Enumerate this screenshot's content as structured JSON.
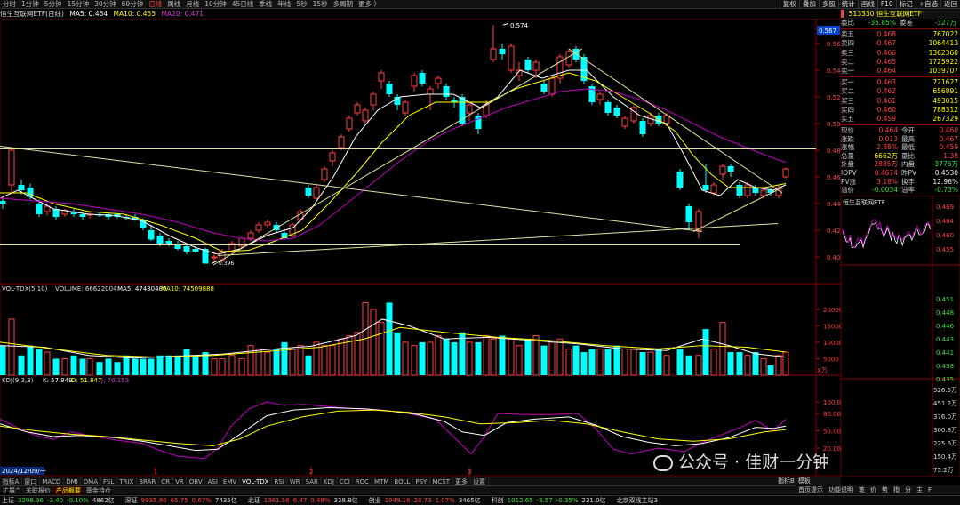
{
  "toolbar": {
    "periods": [
      "分时",
      "1分钟",
      "5分钟",
      "15分钟",
      "30分钟",
      "60分钟",
      "日线",
      "周线",
      "月线",
      "10分钟",
      "45日线",
      "季线",
      "年线",
      "5秒",
      "15秒",
      "多周期",
      "更多 〉"
    ],
    "active_period": "日线",
    "right_buttons": [
      "复权",
      "叠加",
      "多股",
      "统计",
      "画线",
      "F10",
      "标记",
      "+自选",
      "返回"
    ]
  },
  "chart_header": {
    "name": "恒生互联网ETF(日线)",
    "ma5": "MA5: 0.454",
    "ma10": "MA10: 0.455",
    "ma20": "MA20: 0.471"
  },
  "price_axis": {
    "labels": [
      "0.560",
      "0.540",
      "0.520",
      "0.500",
      "0.480",
      "0.460",
      "0.440",
      "0.420",
      "0.400"
    ],
    "current_price_tag": "0.567",
    "high_label": "0.574",
    "low_label": "0.396"
  },
  "volume_header": {
    "name": "VOL-TDX(5,10)",
    "volume": "VOLUME: 66622004",
    "ma5": "MA5: 47430480",
    "ma10": "MA10: 74509888"
  },
  "volume_axis": {
    "labels": [
      "20000",
      "15000",
      "10000",
      "5000"
    ],
    "unit": "X万"
  },
  "kdj_header": {
    "name": "KDJ(9,3,3)",
    "k": "K: 57.949",
    "d": "D: 51.847",
    "j": "J: 70.153"
  },
  "kdj_axis": {
    "labels": [
      "100.00",
      "80.00",
      "50.00",
      "20.00"
    ]
  },
  "date_label": "2024/12/09/一",
  "month_marks": [
    "1",
    "2",
    "3"
  ],
  "quote": {
    "code": "513330 恒生互联网ETF",
    "weibi_label": "委比",
    "weibi": "-35.85%",
    "weicha_label": "委差",
    "weicha": "-327万",
    "asks": [
      {
        "label": "卖五",
        "price": "0.468",
        "vol": "767022"
      },
      {
        "label": "卖四",
        "price": "0.467",
        "vol": "1064413"
      },
      {
        "label": "卖三",
        "price": "0.466",
        "vol": "1362360"
      },
      {
        "label": "卖二",
        "price": "0.465",
        "vol": "1725922"
      },
      {
        "label": "卖一",
        "price": "0.464",
        "vol": "1039707"
      }
    ],
    "bids": [
      {
        "label": "买一",
        "price": "0.463",
        "vol": "721627"
      },
      {
        "label": "买二",
        "price": "0.462",
        "vol": "656891"
      },
      {
        "label": "买三",
        "price": "0.461",
        "vol": "493015"
      },
      {
        "label": "买四",
        "price": "0.460",
        "vol": "788312"
      },
      {
        "label": "买五",
        "price": "0.459",
        "vol": "267329"
      }
    ],
    "stats": [
      {
        "l1": "现价",
        "v1": "0.464",
        "c1": "red",
        "l2": "今开",
        "v2": "0.460",
        "c2": "red"
      },
      {
        "l1": "涨跌",
        "v1": "0.013",
        "c1": "red",
        "l2": "最高",
        "v2": "0.467",
        "c2": "red"
      },
      {
        "l1": "涨幅",
        "v1": "2.88%",
        "c1": "red",
        "l2": "最低",
        "v2": "0.459",
        "c2": "red"
      },
      {
        "l1": "总量",
        "v1": "6662万",
        "c1": "yel",
        "l2": "量比",
        "v2": "1.38",
        "c2": "red"
      },
      {
        "l1": "外盘",
        "v1": "2885万",
        "c1": "red",
        "l2": "内盘",
        "v2": "3776万",
        "c2": "grn"
      },
      {
        "l1": "IOPV",
        "v1": "0.4674",
        "c1": "red",
        "l2": "昨PV",
        "v2": "0.4530",
        "c2": "wht"
      },
      {
        "l1": "PV涨",
        "v1": "3.18%",
        "c1": "red",
        "l2": "换手",
        "v2": "12.96%",
        "c2": "wht"
      },
      {
        "l1": "溢价",
        "v1": "-0.0034",
        "c1": "grn",
        "l2": "溢率",
        "v2": "-0.73%",
        "c2": "grn"
      }
    ]
  },
  "mini_chart": {
    "title": "恒生互联网ETF",
    "price_labels": [
      "0.469",
      "0.464",
      "0.460",
      "0.455"
    ],
    "vol_labels": [
      "0.451",
      "0.448",
      "0.446",
      "0.443",
      "0.441",
      "0.438",
      "0.435"
    ],
    "amt_labels": [
      "526.5万",
      "451.2万",
      "376.0万",
      "300.8万",
      "225.6万",
      "150.4万",
      "75.2万"
    ]
  },
  "indicator_tabs": [
    "指标A",
    "窗口",
    "MACD",
    "DMI",
    "DMA",
    "FSL",
    "TRIX",
    "BRAR",
    "CR",
    "VR",
    "OBV",
    "ASI",
    "EMV",
    "VOL-TDX",
    "RSI",
    "WR",
    "SAR",
    "KDJ",
    "CCI",
    "ROC",
    "MTM",
    "BOLL",
    "PSY",
    "MCST",
    "更多",
    "设置"
  ],
  "active_indicator": "VOL-TDX",
  "bottom_right_tabs": [
    "指标B",
    "模板"
  ],
  "sub_tabs": [
    "扩展^",
    "关联报价",
    "产品概要",
    "基金持仓"
  ],
  "active_sub_tab": "产品概要",
  "mini_tabs": [
    "首页提示",
    "功能说明",
    "笔",
    "价",
    "势",
    "指",
    "分",
    "主",
    "F"
  ],
  "status": [
    {
      "name": "上证",
      "val": "3298.36",
      "chg": "-3.40",
      "pct": "-0.10%",
      "amt": "4862亿"
    },
    {
      "name": "深证",
      "val": "9935.80",
      "chg": "65.75",
      "pct": "0.67%",
      "amt": "7435亿"
    },
    {
      "name": "北证",
      "val": "1361.56",
      "chg": "6.47",
      "pct": "0.48%",
      "amt": "328.8亿"
    },
    {
      "name": "创业",
      "val": "1949.16",
      "chg": "20.73",
      "pct": "1.07%",
      "amt": "3465亿"
    },
    {
      "name": "科创",
      "val": "1012.65",
      "chg": "-3.57",
      "pct": "-0.35%",
      "amt": "231.0亿"
    }
  ],
  "status_tail": "北京双线主站3",
  "watermark": "公众号 · 佳财一分钟",
  "colors": {
    "up": "#ff4040",
    "down": "#00ffff",
    "ma5": "#ffffff",
    "ma10": "#ffff00",
    "ma20": "#c000c0"
  }
}
